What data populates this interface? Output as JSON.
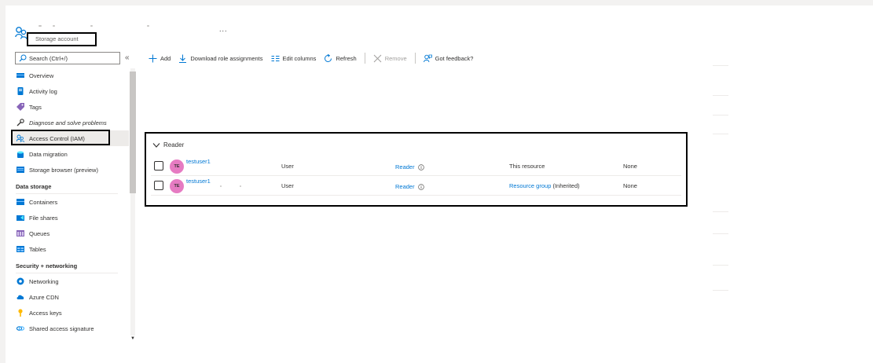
{
  "header": {
    "resource_type_label": "Storage account",
    "more_label": "...",
    "icon": "people-icon"
  },
  "sidebar": {
    "search_placeholder": "Search (Ctrl+/)",
    "collapse_label": "«",
    "items_top": [
      {
        "label": "Overview",
        "icon": "overview-icon",
        "color": "#0078d4"
      },
      {
        "label": "Activity log",
        "icon": "activity-log-icon",
        "color": "#0078d4"
      },
      {
        "label": "Tags",
        "icon": "tag-icon",
        "color": "#8764b8"
      },
      {
        "label": "Diagnose and solve problems",
        "icon": "wrench-icon",
        "color": "#323130"
      },
      {
        "label": "Access Control (IAM)",
        "icon": "people-icon",
        "color": "#0078d4",
        "selected": true
      },
      {
        "label": "Data migration",
        "icon": "data-migration-icon",
        "color": "#0078d4"
      },
      {
        "label": "Storage browser (preview)",
        "icon": "storage-browser-icon",
        "color": "#0078d4"
      }
    ],
    "section_data_storage": "Data storage",
    "items_data_storage": [
      {
        "label": "Containers",
        "icon": "containers-icon",
        "color": "#0078d4"
      },
      {
        "label": "File shares",
        "icon": "file-shares-icon",
        "color": "#0078d4"
      },
      {
        "label": "Queues",
        "icon": "queues-icon",
        "color": "#8764b8"
      },
      {
        "label": "Tables",
        "icon": "tables-icon",
        "color": "#0078d4"
      }
    ],
    "section_security": "Security + networking",
    "items_security": [
      {
        "label": "Networking",
        "icon": "networking-icon",
        "color": "#0078d4"
      },
      {
        "label": "Azure CDN",
        "icon": "cloud-icon",
        "color": "#0078d4"
      },
      {
        "label": "Access keys",
        "icon": "key-icon",
        "color": "#ffb900"
      },
      {
        "label": "Shared access signature",
        "icon": "link-icon",
        "color": "#0078d4"
      }
    ]
  },
  "toolbar": {
    "add": "Add",
    "download": "Download role assignments",
    "edit_columns": "Edit columns",
    "refresh": "Refresh",
    "remove": "Remove",
    "feedback": "Got feedback?"
  },
  "table": {
    "group_label": "Reader",
    "rows": [
      {
        "avatar": "TE",
        "name": "testuser1",
        "type": "User",
        "role": "Reader",
        "scope_link": "",
        "scope_text": "This resource",
        "condition": "None"
      },
      {
        "avatar": "TE",
        "name": "testuser1",
        "type": "User",
        "role": "Reader",
        "scope_link": "Resource group",
        "scope_text": " (Inherited)",
        "condition": "None"
      }
    ]
  },
  "colors": {
    "accent": "#0078d4",
    "avatar": "#e67bc2"
  }
}
